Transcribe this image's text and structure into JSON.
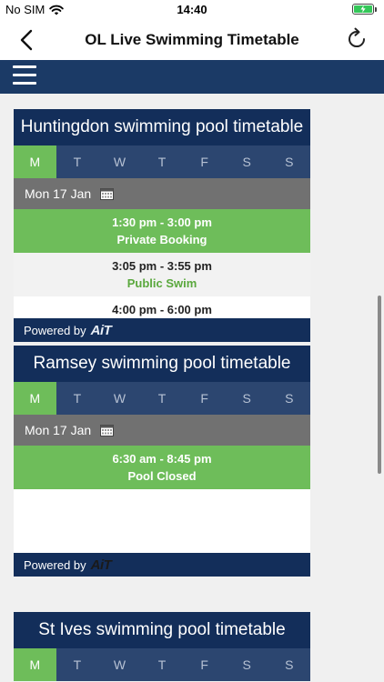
{
  "status_bar": {
    "carrier": "No SIM",
    "time": "14:40"
  },
  "nav": {
    "title": "OL Live Swimming Timetable"
  },
  "colors": {
    "brand_navy": "#132e5a",
    "accent_green": "#6ebd5a"
  },
  "widgets": [
    {
      "title": "Huntingdon swimming pool timetable",
      "days": [
        "M",
        "T",
        "W",
        "T",
        "F",
        "S",
        "S"
      ],
      "date": "Mon 17 Jan",
      "slots": [
        {
          "time": "1:30 pm - 3:00 pm",
          "activity": "Private Booking"
        },
        {
          "time": "3:05 pm - 3:55 pm",
          "activity": "Public Swim"
        },
        {
          "time": "4:00 pm - 6:00 pm"
        }
      ],
      "powered_by": "Powered by",
      "logo": "AiT"
    },
    {
      "title": "Ramsey swimming pool timetable",
      "days": [
        "M",
        "T",
        "W",
        "T",
        "F",
        "S",
        "S"
      ],
      "date": "Mon 17 Jan",
      "slots": [
        {
          "time": "6:30 am - 8:45 pm",
          "activity": "Pool Closed"
        }
      ],
      "powered_by": "Powered by",
      "logo": "AiT"
    },
    {
      "title": "St Ives swimming pool timetable",
      "days": [
        "M",
        "T",
        "W",
        "T",
        "F",
        "S",
        "S"
      ]
    }
  ]
}
